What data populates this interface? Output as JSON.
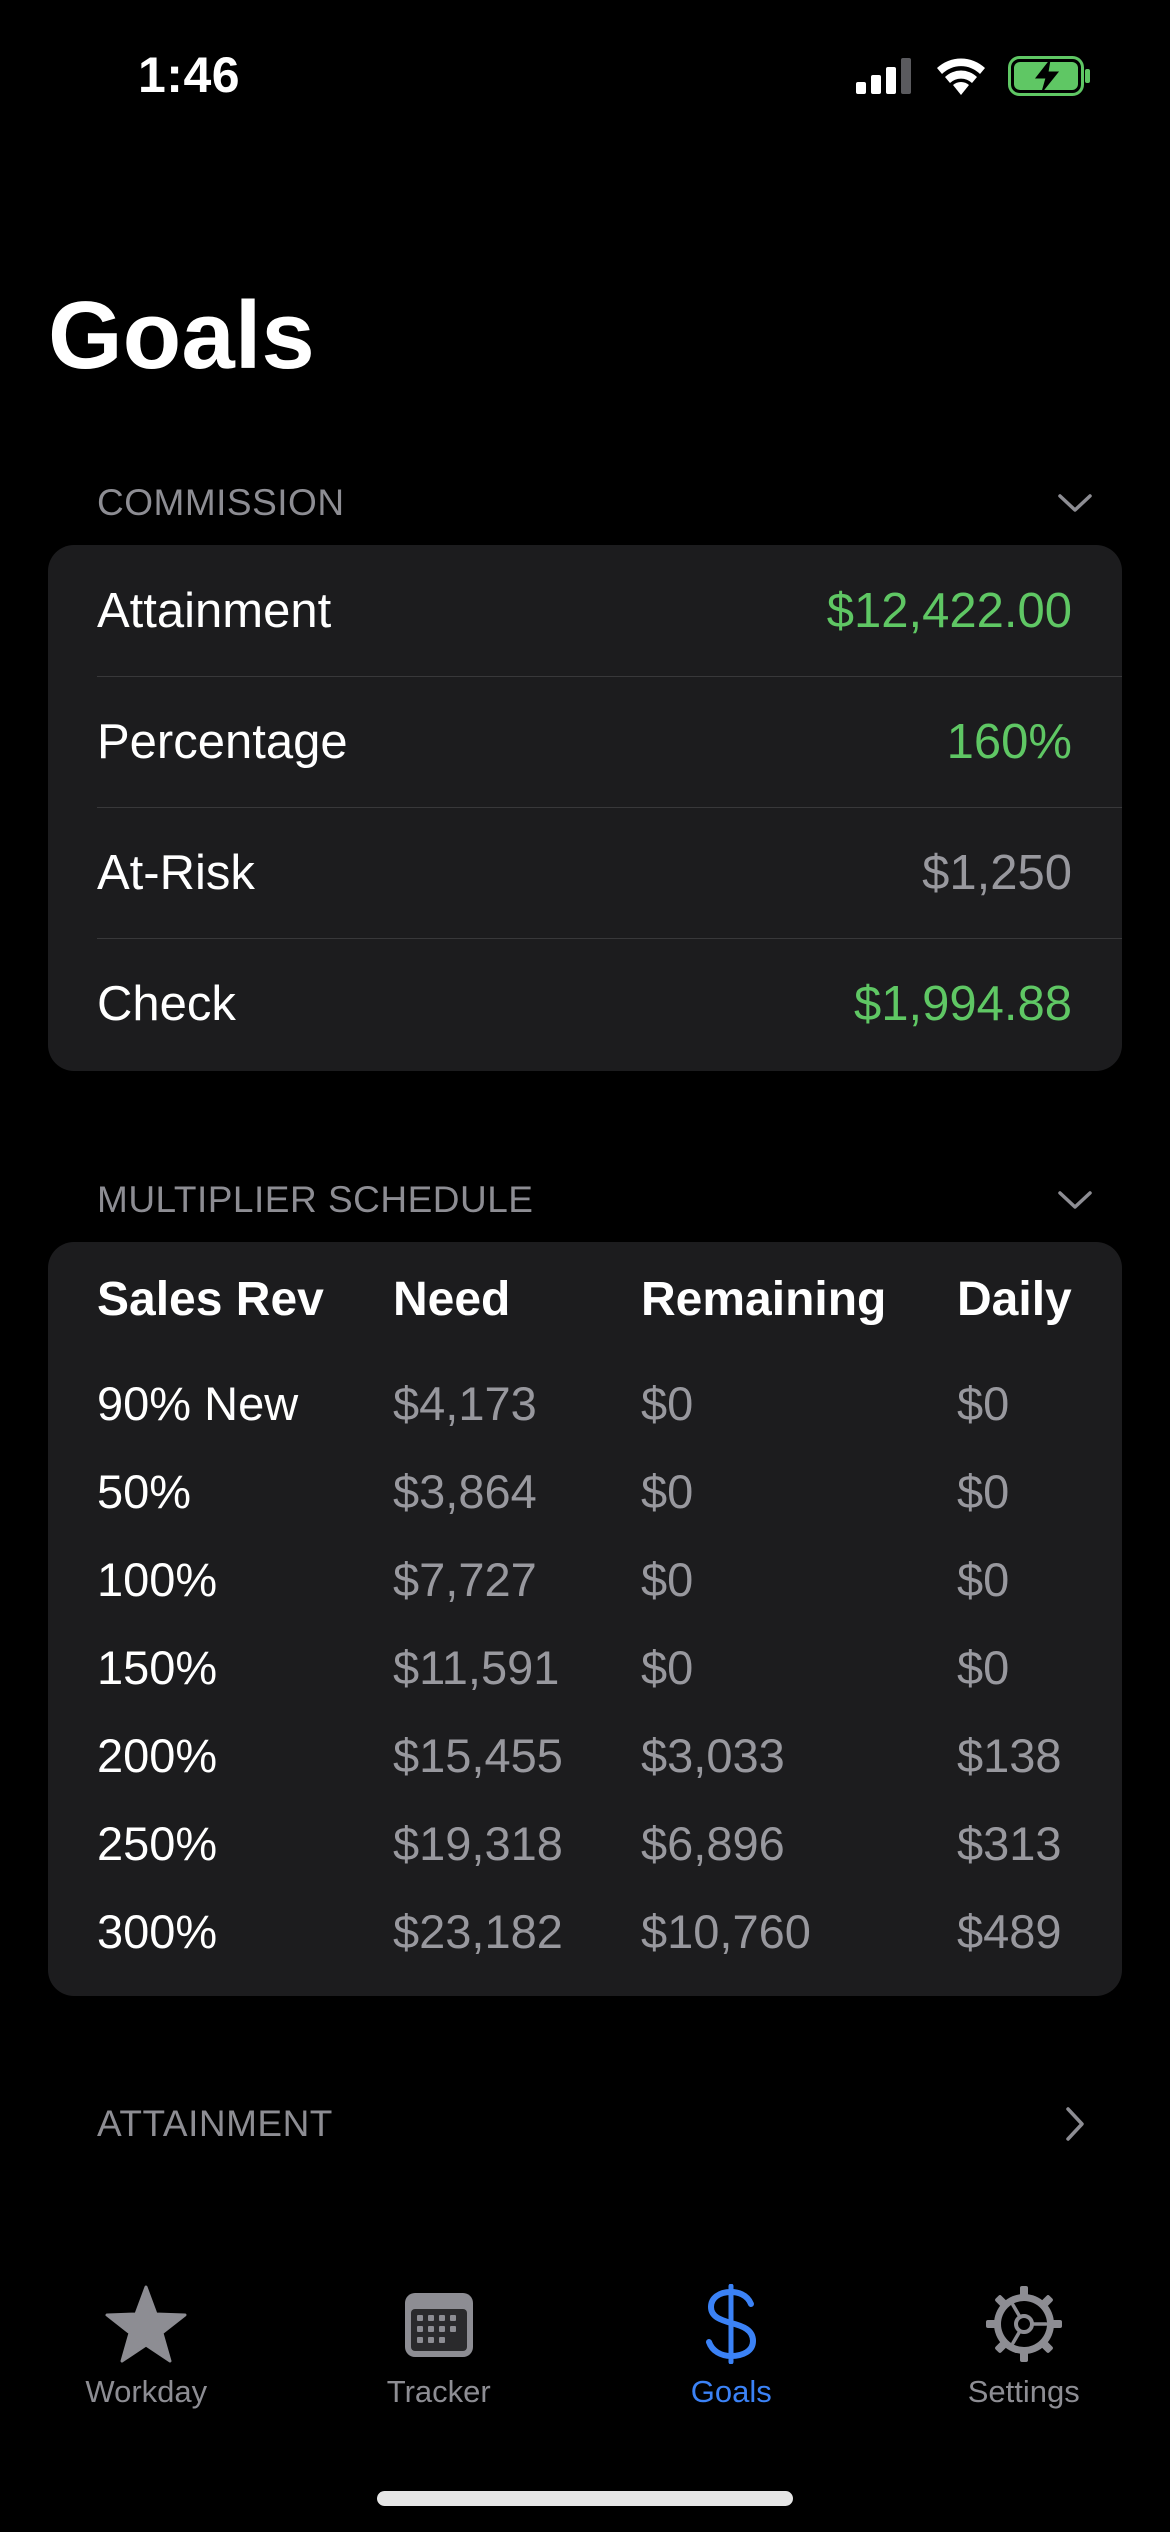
{
  "status_bar": {
    "time": "1:46",
    "icons": [
      "cellular-signal-icon",
      "wifi-icon",
      "battery-charging-icon"
    ],
    "battery_color": "#5fc764"
  },
  "title": "Goals",
  "commission": {
    "header": "COMMISSION",
    "rows": [
      {
        "label": "Attainment",
        "value": "$12,422.00",
        "color": "#5fc764"
      },
      {
        "label": "Percentage",
        "value": "160%",
        "color": "#5fc764"
      },
      {
        "label": "At-Risk",
        "value": "$1,250",
        "color": "#98989e"
      },
      {
        "label": "Check",
        "value": "$1,994.88",
        "color": "#5fc764"
      }
    ]
  },
  "multiplier": {
    "header": "MULTIPLIER SCHEDULE",
    "columns": [
      "Sales Rev",
      "Need",
      "Remaining",
      "Daily"
    ],
    "rows": [
      [
        "90% New",
        "$4,173",
        "$0",
        "$0"
      ],
      [
        "50%",
        "$3,864",
        "$0",
        "$0"
      ],
      [
        "100%",
        "$7,727",
        "$0",
        "$0"
      ],
      [
        "150%",
        "$11,591",
        "$0",
        "$0"
      ],
      [
        "200%",
        "$15,455",
        "$3,033",
        "$138"
      ],
      [
        "250%",
        "$19,318",
        "$6,896",
        "$313"
      ],
      [
        "300%",
        "$23,182",
        "$10,760",
        "$489"
      ]
    ]
  },
  "attainment_section": {
    "header": "ATTAINMENT"
  },
  "tab_bar": {
    "tabs": [
      {
        "label": "Workday",
        "icon": "star-icon",
        "active": false
      },
      {
        "label": "Tracker",
        "icon": "calendar-icon",
        "active": false
      },
      {
        "label": "Goals",
        "icon": "dollar-sign-icon",
        "active": true
      },
      {
        "label": "Settings",
        "icon": "gear-icon",
        "active": false
      }
    ],
    "active_color": "#3b82f6",
    "inactive_color": "#8d8d93"
  }
}
